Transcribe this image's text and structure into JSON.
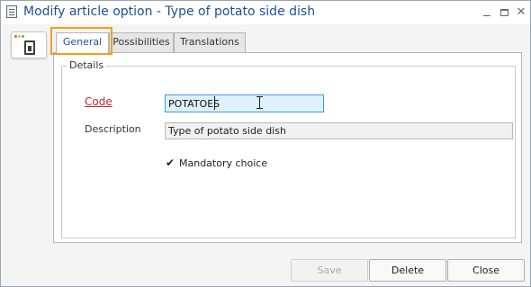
{
  "window": {
    "title": "Modify article option - Type of potato side dish",
    "title_color": "#1f4e9a"
  },
  "tabs": [
    {
      "label": "General",
      "active": true
    },
    {
      "label": "Possibilities",
      "active": false
    },
    {
      "label": "Translations",
      "active": false
    }
  ],
  "details": {
    "group_label": "Details",
    "code_label": "Code",
    "code_value": "POTATOES",
    "description_label": "Description",
    "description_value": "Type of potato side dish",
    "mandatory_label": "Mandatory choice",
    "mandatory_checked": true
  },
  "buttons": {
    "save": "Save",
    "delete": "Delete",
    "close": "Close"
  },
  "colors": {
    "required_label": "#c8262a",
    "focus_border": "#3aa0d8",
    "highlight_frame": "#f0a020"
  },
  "icons": {
    "title": "document-icon",
    "app": "article-option-icon",
    "check": "✔"
  }
}
